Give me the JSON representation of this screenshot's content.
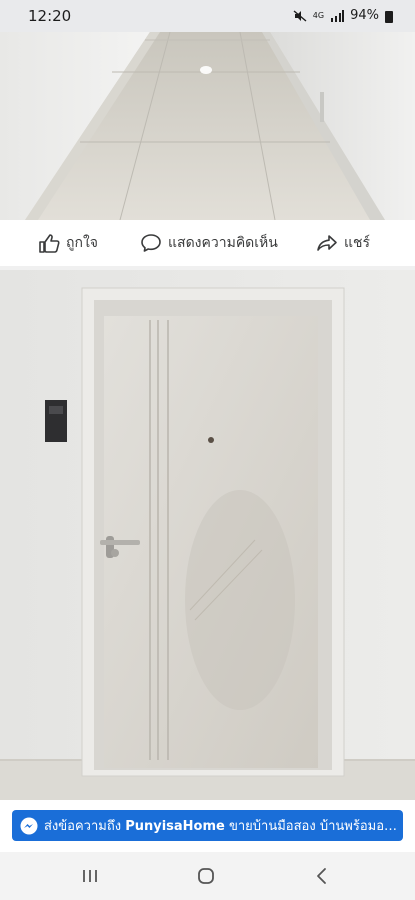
{
  "status": {
    "time": "12:20",
    "network": "4G",
    "battery": "94%"
  },
  "actions": {
    "like": "ถูกใจ",
    "comment": "แสดงความคิดเห็น",
    "share": "แชร์"
  },
  "banner": {
    "prefix": "ส่งข้อความถึง",
    "page_name": "PunyisaHome",
    "suffix": "ขายบ้านมือสอง บ้านพร้อมอยู่ บ้..."
  },
  "colors": {
    "accent": "#1a6ed8",
    "status_bar": "#e9eaec",
    "nav_bar": "#f3f3f3"
  },
  "icons": {
    "like": "thumbs-up-icon",
    "comment": "speech-bubble-icon",
    "share": "share-arrow-icon",
    "messenger": "messenger-icon",
    "recent": "recent-apps-icon",
    "home": "home-icon",
    "back": "back-icon"
  }
}
